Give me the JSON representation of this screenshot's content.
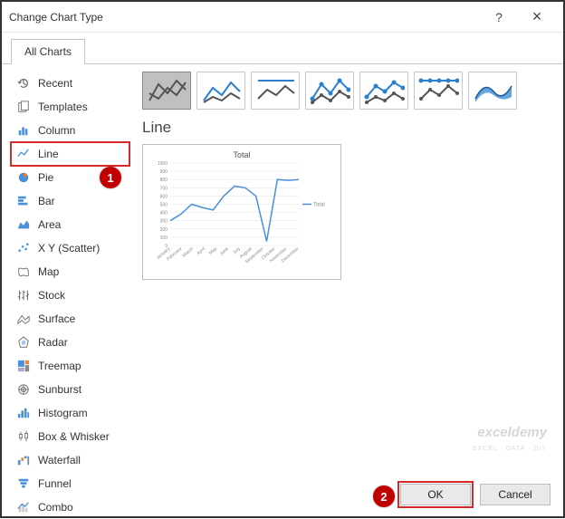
{
  "titlebar": {
    "title": "Change Chart Type",
    "help": "?",
    "close": "×"
  },
  "tabs": {
    "all_charts": "All Charts"
  },
  "sidebar": {
    "items": [
      {
        "icon": "recent-icon",
        "label": "Recent"
      },
      {
        "icon": "templates-icon",
        "label": "Templates"
      },
      {
        "icon": "column-icon",
        "label": "Column"
      },
      {
        "icon": "line-icon",
        "label": "Line"
      },
      {
        "icon": "pie-icon",
        "label": "Pie"
      },
      {
        "icon": "bar-icon",
        "label": "Bar"
      },
      {
        "icon": "area-icon",
        "label": "Area"
      },
      {
        "icon": "scatter-icon",
        "label": "X Y (Scatter)"
      },
      {
        "icon": "map-icon",
        "label": "Map"
      },
      {
        "icon": "stock-icon",
        "label": "Stock"
      },
      {
        "icon": "surface-icon",
        "label": "Surface"
      },
      {
        "icon": "radar-icon",
        "label": "Radar"
      },
      {
        "icon": "treemap-icon",
        "label": "Treemap"
      },
      {
        "icon": "sunburst-icon",
        "label": "Sunburst"
      },
      {
        "icon": "histogram-icon",
        "label": "Histogram"
      },
      {
        "icon": "boxwhisker-icon",
        "label": "Box & Whisker"
      },
      {
        "icon": "waterfall-icon",
        "label": "Waterfall"
      },
      {
        "icon": "funnel-icon",
        "label": "Funnel"
      },
      {
        "icon": "combo-icon",
        "label": "Combo"
      }
    ],
    "selected_index": 3
  },
  "main": {
    "section_title": "Line",
    "subtypes": [
      "line",
      "stacked-line",
      "100-stacked-line",
      "line-markers",
      "stacked-line-markers",
      "100-stacked-line-markers",
      "3d-line"
    ],
    "selected_subtype": 0,
    "preview": {
      "title": "Total",
      "legend": "Total"
    }
  },
  "chart_data": {
    "type": "line",
    "title": "Total",
    "categories": [
      "January",
      "February",
      "March",
      "April",
      "May",
      "June",
      "July",
      "August",
      "September",
      "October",
      "November",
      "December"
    ],
    "series": [
      {
        "name": "Total",
        "values": [
          300,
          380,
          500,
          460,
          430,
          600,
          720,
          700,
          600,
          50,
          800,
          790,
          800
        ]
      }
    ],
    "ylabel": "",
    "xlabel": "",
    "ylim": [
      0,
      1000
    ],
    "yticks": [
      0,
      100,
      200,
      300,
      400,
      500,
      600,
      700,
      800,
      900,
      1000
    ]
  },
  "footer": {
    "ok": "OK",
    "cancel": "Cancel"
  },
  "badges": {
    "one": "1",
    "two": "2"
  },
  "watermark": {
    "brand": "exceldemy",
    "tag": "EXCEL · DATA · DIY"
  }
}
